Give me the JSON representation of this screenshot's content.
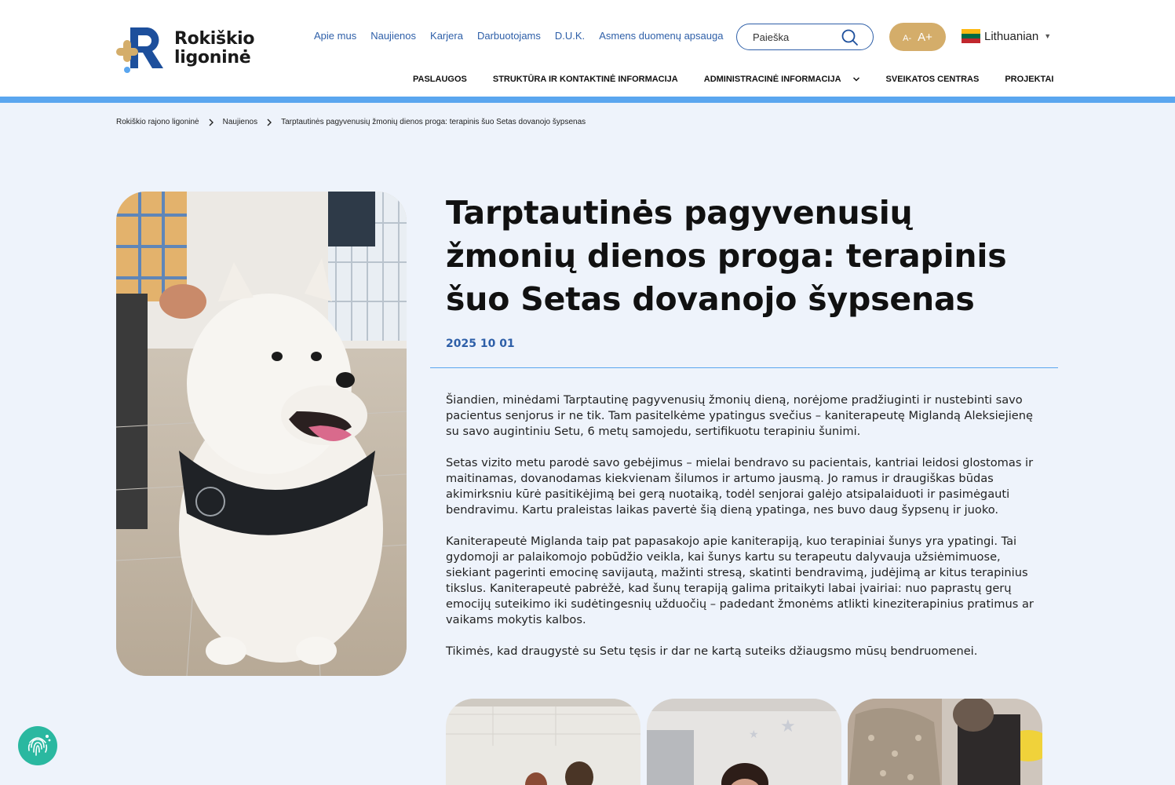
{
  "brand": {
    "line1": "Rokiškio",
    "line2": "ligoninė",
    "colors": {
      "navy": "#1d4f9c",
      "gold": "#d4ad6a",
      "light_blue": "#5aa6ef"
    }
  },
  "topnav": [
    "Apie mus",
    "Naujienos",
    "Karjera",
    "Darbuotojams",
    "D.U.K.",
    "Asmens duomenų apsauga"
  ],
  "search": {
    "placeholder": "Paieška",
    "icon": "search-icon"
  },
  "font_controls": {
    "decrease": "A-",
    "increase": "A+"
  },
  "language": {
    "selected": "Lithuanian"
  },
  "mainnav": [
    "PASLAUGOS",
    "STRUKTŪRA IR KONTAKTINĖ INFORMACIJA",
    "ADMINISTRACINĖ INFORMACIJA",
    "SVEIKATOS CENTRAS",
    "PROJEKTAI"
  ],
  "breadcrumb": [
    "Rokiškio rajono ligoninė",
    "Naujienos",
    "Tarptautinės pagyvenusių žmonių dienos proga: terapinis šuo Setas dovanojo šypsenas"
  ],
  "article": {
    "title": "Tarptautinės pagyvenusių žmonių dienos proga: terapinis šuo Setas dovanojo šypsenas",
    "date": "2025 10 01",
    "paragraphs": [
      "Šiandien, minėdami Tarptautinę pagyvenusių žmonių dieną, norėjome pradžiuginti ir nustebinti savo pacientus senjorus ir ne tik. Tam pasitelkėme ypatingus svečius – kaniterapeutę Miglandą Aleksiejienę su savo augintiniu Setu, 6 metų samojedu, sertifikuotu terapiniu šunimi.",
      "Setas vizito metu parodė savo gebėjimus – mielai bendravo su pacientais, kantriai leidosi glostomas ir maitinamas, dovanodamas kiekvienam šilumos ir artumo jausmą. Jo ramus ir draugiškas būdas akimirksniu kūrė pasitikėjimą bei gerą nuotaiką, todėl senjorai galėjo atsipalaiduoti ir pasimėgauti bendravimu. Kartu praleistas laikas pavertė šią dieną ypatinga, nes buvo daug šypsenų ir juoko.",
      "Kaniterapeutė Miglanda taip pat papasakojo apie kaniterapiją, kuo terapiniai šunys yra ypatingi. Tai gydomoji ar palaikomojo pobūdžio veikla, kai šunys kartu su terapeutu dalyvauja užsiėmimuose, siekiant pagerinti emocinę savijautą, mažinti stresą, skatinti bendravimą, judėjimą ar kitus terapinius tikslus. Kaniterapeutė pabrėžė, kad šunų terapiją galima pritaikyti labai įvairiai: nuo paprastų gerų emocijų suteikimo iki sudėtingesnių užduočių – padedant žmonėms atlikti kineziterapinius pratimus ar vaikams mokytis kalbos.",
      "Tikimės, kad draugystė su Setu tęsis ir dar ne kartą suteiks džiaugsmo mūsų bendruomenei."
    ]
  }
}
